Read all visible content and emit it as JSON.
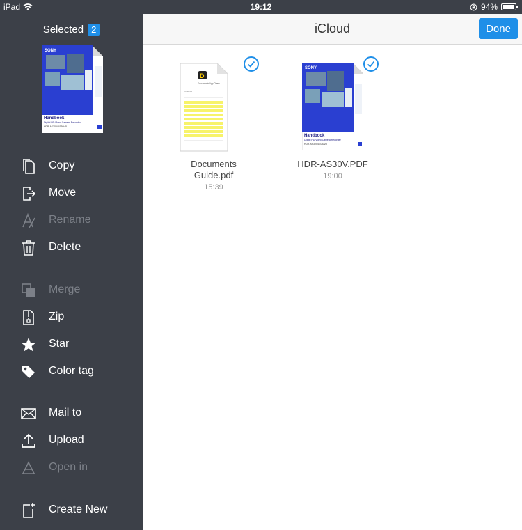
{
  "status_bar": {
    "device": "iPad",
    "time": "19:12",
    "battery": "94%",
    "battery_level": 0.94
  },
  "sidebar": {
    "selected_label": "Selected",
    "selected_count": "2",
    "thumb": {
      "brand": "SONY",
      "title": "Handbook",
      "subtitle": "Digital HD Video Camera Recorder",
      "model": "HDR-AS30V/AS30VR"
    },
    "groups": [
      [
        {
          "label": "Copy",
          "icon": "copy-icon",
          "enabled": true
        },
        {
          "label": "Move",
          "icon": "move-icon",
          "enabled": true
        },
        {
          "label": "Rename",
          "icon": "rename-icon",
          "enabled": false
        },
        {
          "label": "Delete",
          "icon": "trash-icon",
          "enabled": true
        }
      ],
      [
        {
          "label": "Merge",
          "icon": "merge-icon",
          "enabled": false
        },
        {
          "label": "Zip",
          "icon": "zip-icon",
          "enabled": true
        },
        {
          "label": "Star",
          "icon": "star-icon",
          "enabled": true
        },
        {
          "label": "Color tag",
          "icon": "tag-icon",
          "enabled": true
        }
      ],
      [
        {
          "label": "Mail to",
          "icon": "mail-icon",
          "enabled": true
        },
        {
          "label": "Upload",
          "icon": "upload-icon",
          "enabled": true
        },
        {
          "label": "Open in",
          "icon": "open-in-icon",
          "enabled": false
        }
      ],
      [
        {
          "label": "Create New",
          "icon": "create-new-icon",
          "enabled": true
        }
      ]
    ]
  },
  "header": {
    "title": "iCloud",
    "done_label": "Done"
  },
  "files": [
    {
      "name_line1": "Documents",
      "name_line2": "Guide.pdf",
      "time": "15:39",
      "selected": true,
      "doc_title": "Documents App Overv...",
      "doc_heading": "Contents"
    },
    {
      "name_line1": "HDR-AS30V.PDF",
      "name_line2": "",
      "time": "19:00",
      "selected": true
    }
  ],
  "colors": {
    "sidebar": "#3c4048",
    "accent": "#1f8fe8",
    "sony_blue": "#2a3fd1",
    "highlight": "#f7f36a"
  }
}
